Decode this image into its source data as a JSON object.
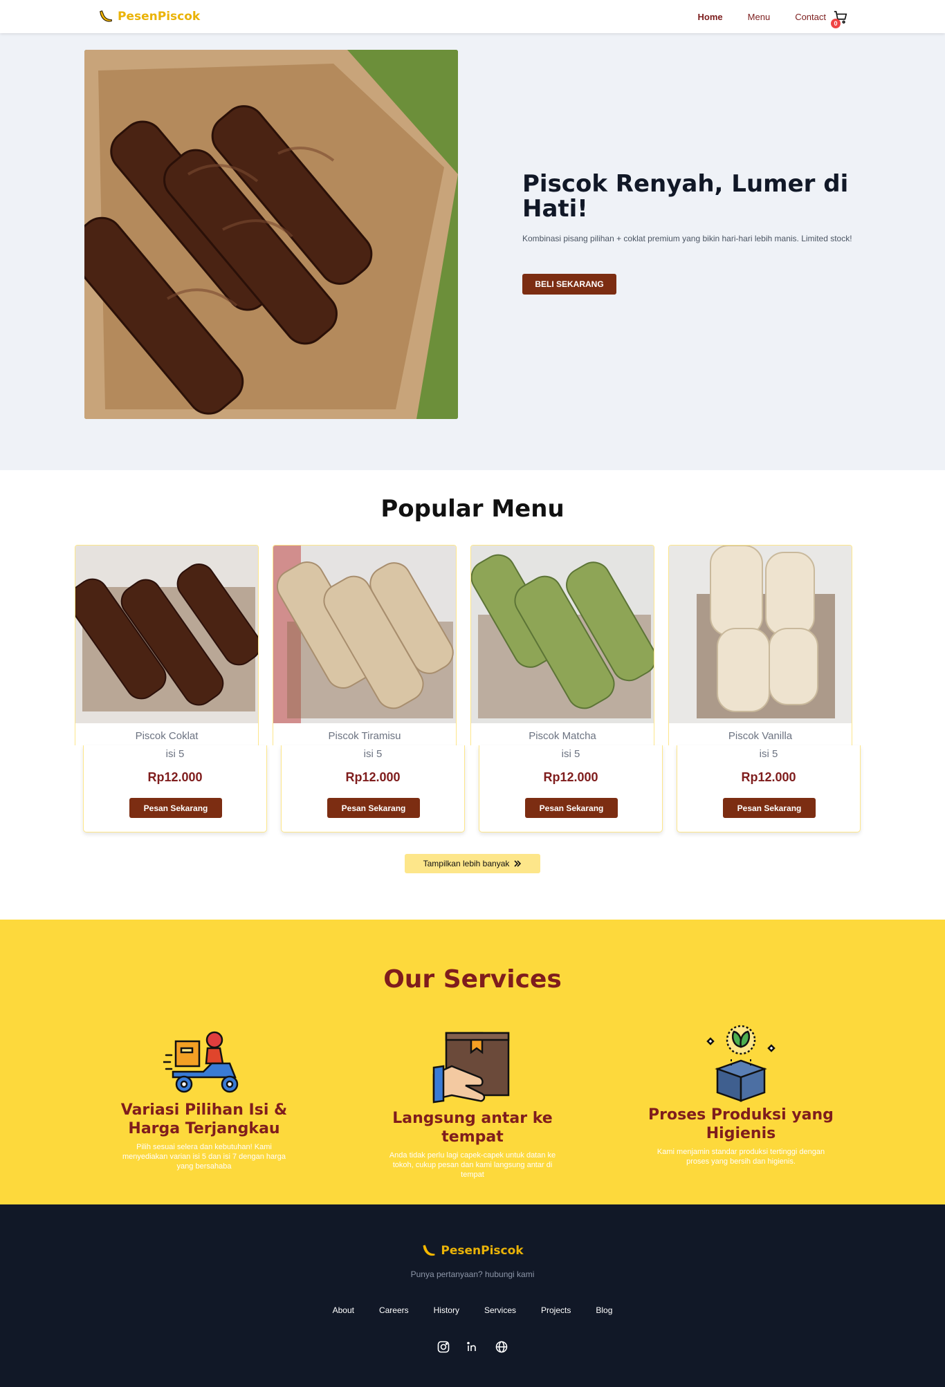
{
  "nav": {
    "brand": "PesenPiscok",
    "links": [
      "Home",
      "Menu",
      "Contact"
    ],
    "cart_count": "0"
  },
  "hero": {
    "title": "Piscok Renyah, Lumer di Hati!",
    "description": "Kombinasi pisang pilihan + coklat premium yang bikin hari-hari lebih manis. Limited stock!",
    "cta": "BELI SEKARANG"
  },
  "popular": {
    "title": "Popular Menu",
    "items": [
      {
        "name": "Piscok Coklat",
        "qty": "isi 5",
        "price": "Rp12.000",
        "button": "Pesan Sekarang"
      },
      {
        "name": "Piscok Tiramisu",
        "qty": "isi 5",
        "price": "Rp12.000",
        "button": "Pesan Sekarang"
      },
      {
        "name": "Piscok Matcha",
        "qty": "isi 5",
        "price": "Rp12.000",
        "button": "Pesan Sekarang"
      },
      {
        "name": "Piscok Vanilla",
        "qty": "isi 5",
        "price": "Rp12.000",
        "button": "Pesan Sekarang"
      }
    ],
    "more_button": "Tampilkan lebih banyak"
  },
  "services": {
    "title": "Our Services",
    "items": [
      {
        "title": "Variasi Pilihan Isi & Harga Terjangkau",
        "description": "Pilih sesuai selera dan kebutuhan! Kami menyediakan varian isi 5 dan isi 7 dengan harga yang bersahaba",
        "icon": "delivery-scooter-icon"
      },
      {
        "title": "Langsung antar ke tempat",
        "description": "Anda tidak perlu lagi capek-capek untuk datan ke tokoh, cukup pesan dan kami langsung antar di tempat",
        "icon": "package-hand-icon"
      },
      {
        "title": "Proses Produksi yang Higienis",
        "description": "Kami menjamin standar produksi tertinggi dengan proses yang bersih dan higienis.",
        "icon": "eco-box-icon"
      }
    ]
  },
  "footer": {
    "brand": "PesenPiscok",
    "tagline": "Punya pertanyaan? hubungi kami",
    "links": [
      "About",
      "Careers",
      "History",
      "Services",
      "Projects",
      "Blog"
    ],
    "social": [
      "instagram-icon",
      "linkedin-icon",
      "globe-icon"
    ]
  },
  "colors": {
    "brand_yellow": "#eab308",
    "primary_brown": "#7c2d12",
    "maroon": "#7f1d1d",
    "services_bg": "#fdd93c",
    "footer_bg": "#111827",
    "hero_bg": "#eff2f7"
  }
}
